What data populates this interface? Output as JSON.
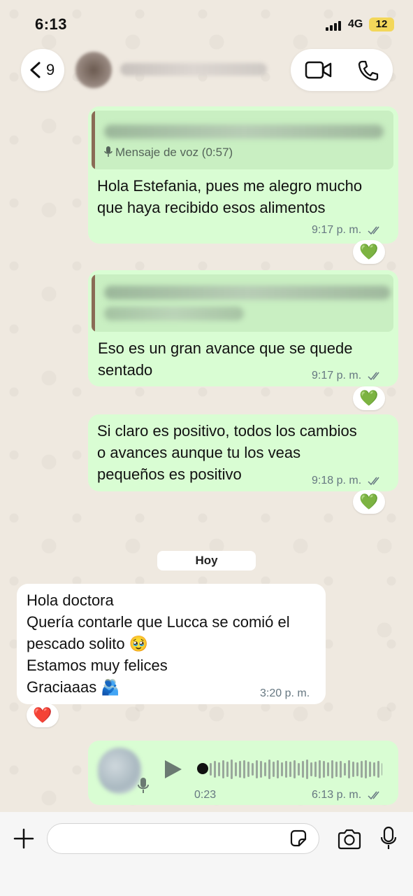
{
  "status_bar": {
    "time": "6:13",
    "network": "4G",
    "battery": "12"
  },
  "header": {
    "back_count": "9"
  },
  "messages": [
    {
      "quote_label": "Mensaje de voz (0:57)",
      "text_lines": [
        "Hola Estefania, pues me alegro mucho",
        "que haya recibido esos alimentos"
      ],
      "time": "9:17 p. m.",
      "reaction": "💚"
    },
    {
      "text_lines": [
        "Eso es un gran avance que se quede",
        "sentado"
      ],
      "time": "9:17 p. m.",
      "reaction": "💚"
    },
    {
      "text_lines": [
        "Si claro es positivo, todos los cambios",
        "o avances aunque tu los veas",
        "pequeños es positivo"
      ],
      "time": "9:18 p. m.",
      "reaction": "💚"
    }
  ],
  "date_separator": "Hoy",
  "incoming": {
    "text_lines": [
      "Hola doctora",
      "Quería contarle que Lucca se comió el",
      "pescado solito 🥹",
      "Estamos muy felices",
      "Graciaaas 🫂"
    ],
    "time": "3:20 p. m.",
    "reaction": "❤️"
  },
  "voice_note": {
    "duration": "0:23",
    "time": "6:13 p. m."
  },
  "icons": {
    "back": "chevron-left-icon",
    "video": "video-call-icon",
    "phone": "phone-icon",
    "plus": "plus-icon",
    "sticker": "sticker-icon",
    "camera": "camera-icon",
    "mic": "microphone-icon"
  },
  "colors": {
    "outgoing_bubble": "#d9fdd3",
    "incoming_bubble": "#ffffff",
    "quote_bar": "#8a6b55"
  }
}
